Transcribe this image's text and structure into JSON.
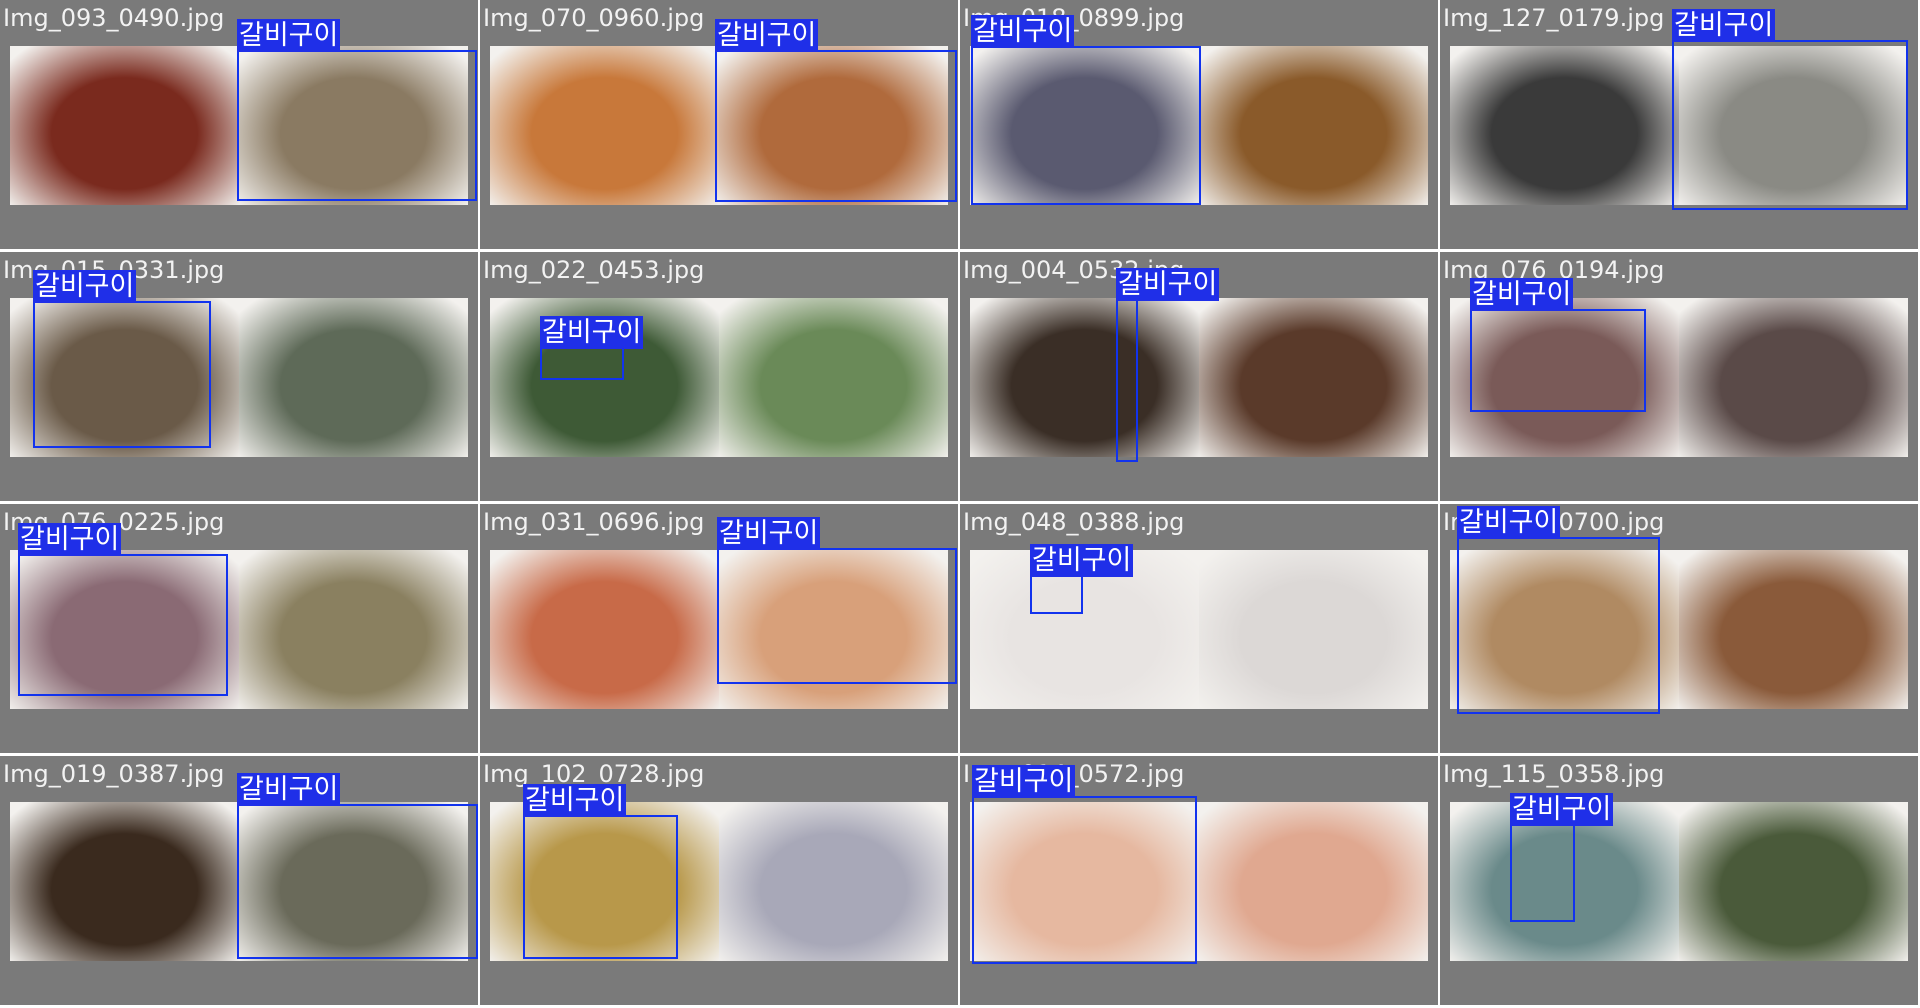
{
  "detection_label": "갈비구이",
  "box_color": "#1233ee",
  "tiles": [
    {
      "filename": "Img_093_0490.jpg",
      "colors": [
        "#7a2a1e",
        "#8a7a62"
      ]
    },
    {
      "filename": "Img_070_0960.jpg",
      "colors": [
        "#c8783a",
        "#b06a3c"
      ]
    },
    {
      "filename": "Img_018_0899.jpg",
      "colors": [
        "#5a5a70",
        "#8a5a2a"
      ]
    },
    {
      "filename": "Img_127_0179.jpg",
      "colors": [
        "#3a3a3a",
        "#8a8a84"
      ]
    },
    {
      "filename": "Img_015_0331.jpg",
      "colors": [
        "#6a5a48",
        "#5e6a58"
      ]
    },
    {
      "filename": "Img_022_0453.jpg",
      "colors": [
        "#3e5a36",
        "#6a8a58"
      ]
    },
    {
      "filename": "Img_004_0532.jpg",
      "colors": [
        "#3a2e26",
        "#5a3a2a"
      ]
    },
    {
      "filename": "Img_076_0194.jpg",
      "colors": [
        "#7a5a58",
        "#5a4a48"
      ]
    },
    {
      "filename": "Img_076_0225.jpg",
      "colors": [
        "#8a6a74",
        "#8a8060"
      ]
    },
    {
      "filename": "Img_031_0696.jpg",
      "colors": [
        "#c86a48",
        "#d8a07a"
      ]
    },
    {
      "filename": "Img_048_0388.jpg",
      "colors": [
        "#e8e4e2",
        "#dcd8d6"
      ]
    },
    {
      "filename": "Img_045_0700.jpg",
      "colors": [
        "#b08a62",
        "#8a5a3a"
      ]
    },
    {
      "filename": "Img_019_0387.jpg",
      "colors": [
        "#3a2a1e",
        "#6a6a5a"
      ]
    },
    {
      "filename": "Img_102_0728.jpg",
      "colors": [
        "#b8984a",
        "#a8a8b8"
      ]
    },
    {
      "filename": "Img_014_0572.jpg",
      "colors": [
        "#e6b8a0",
        "#e0a890"
      ]
    },
    {
      "filename": "Img_115_0358.jpg",
      "colors": [
        "#6a8a8a",
        "#4a5a3a"
      ]
    }
  ]
}
